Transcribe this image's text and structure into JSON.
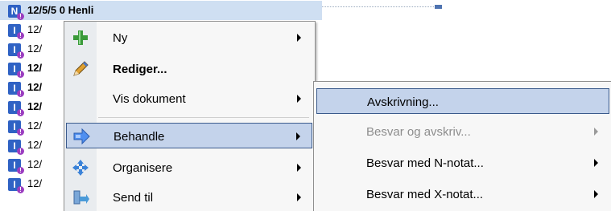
{
  "list": {
    "rows": [
      {
        "icon_letter": "N",
        "date": "12/5/5 0 Henli",
        "bold": true,
        "selected": true
      },
      {
        "icon_letter": "I",
        "date": "12/",
        "bold": false,
        "selected": false
      },
      {
        "icon_letter": "I",
        "date": "12/",
        "bold": false,
        "selected": false
      },
      {
        "icon_letter": "I",
        "date": "12/",
        "bold": true,
        "selected": false
      },
      {
        "icon_letter": "I",
        "date": "12/",
        "bold": true,
        "selected": false
      },
      {
        "icon_letter": "I",
        "date": "12/",
        "bold": true,
        "selected": false
      },
      {
        "icon_letter": "I",
        "date": "12/",
        "bold": false,
        "selected": false
      },
      {
        "icon_letter": "I",
        "date": "12/",
        "bold": false,
        "selected": false
      },
      {
        "icon_letter": "I",
        "date": "12/",
        "bold": false,
        "selected": false
      },
      {
        "icon_letter": "I",
        "date": "12/",
        "bold": false,
        "selected": false
      }
    ]
  },
  "context_menu": {
    "items": [
      {
        "label": "Ny",
        "icon": "plus-icon",
        "submenu": true
      },
      {
        "label": "Rediger...",
        "icon": "pencil-icon",
        "bold": true
      },
      {
        "label": "Vis dokument",
        "icon": "",
        "submenu": true
      },
      {
        "label": "Behandle",
        "icon": "process-arrow-icon",
        "submenu": true,
        "highlighted": true
      },
      {
        "label": "Organisere",
        "icon": "move-arrows-icon",
        "submenu": true
      },
      {
        "label": "Send til",
        "icon": "send-icon",
        "submenu": true
      }
    ]
  },
  "submenu": {
    "items": [
      {
        "label": "Avskrivning...",
        "highlighted": true
      },
      {
        "label": "Besvar og avskriv...",
        "disabled": true,
        "submenu": true
      },
      {
        "label": "Besvar med N-notat...",
        "submenu": true
      },
      {
        "label": "Besvar med X-notat...",
        "submenu": true
      }
    ]
  },
  "colors": {
    "selection": "#cfdff2",
    "menu_highlight": "#c4d3eb",
    "doc_icon": "#2f62c4"
  }
}
